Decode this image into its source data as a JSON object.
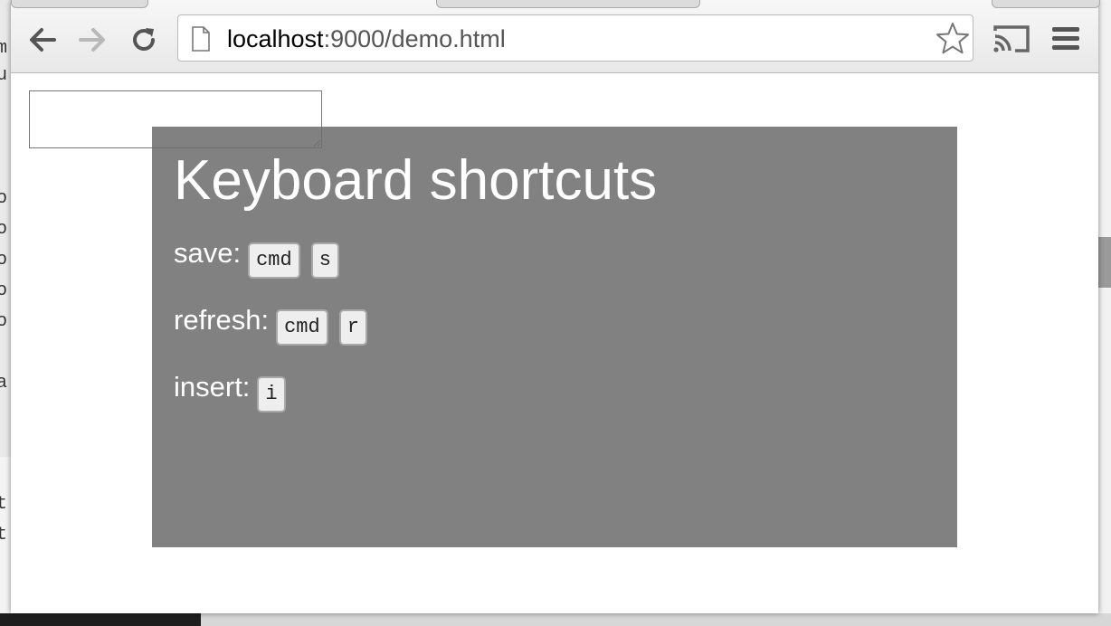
{
  "browser": {
    "url_host": "localhost",
    "url_path": ":9000/demo.html",
    "buttons": {
      "back": "back-icon",
      "forward": "forward-icon",
      "reload": "reload-icon",
      "bookmark": "star-icon",
      "cast": "cast-icon",
      "menu": "hamburger-menu-icon"
    }
  },
  "page": {
    "textarea_value": "",
    "overlay": {
      "title": "Keyboard shortcuts",
      "shortcuts": [
        {
          "label": "save:",
          "keys": [
            "cmd",
            "s"
          ]
        },
        {
          "label": "refresh:",
          "keys": [
            "cmd",
            "r"
          ]
        },
        {
          "label": "insert:",
          "keys": [
            "i"
          ]
        }
      ]
    }
  },
  "colors": {
    "overlay_bg": "#7f7f7f",
    "key_bg": "#eeeeee",
    "overlay_text": "#ffffff"
  }
}
